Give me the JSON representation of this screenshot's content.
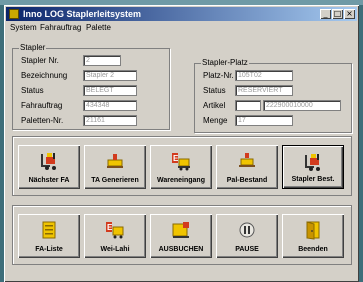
{
  "window": {
    "title": "Inno LOG Staplerleitsystem"
  },
  "menu": [
    "System",
    "Fahrauftrag",
    "Palette"
  ],
  "stapler": {
    "group_label": "Stapler",
    "fields": [
      {
        "label": "Stapler Nr.",
        "value": "2"
      },
      {
        "label": "Bezeichnung",
        "value": "Stapler 2"
      },
      {
        "label": "Status",
        "value": "BELEGT"
      },
      {
        "label": "Fahrauftrag",
        "value": "434348"
      },
      {
        "label": "Paletten-Nr.",
        "value": "21161"
      }
    ]
  },
  "stapler_platz": {
    "group_label": "Stapler-Platz",
    "platz_label": "Platz-Nr.",
    "platz_value": "105T02",
    "status_label": "Status",
    "status_value": "RESERVIERT",
    "artikel_label": "Artikel",
    "artikel_value_1": "",
    "artikel_value_2": "222900010000",
    "menge_label": "Menge",
    "menge_value": "17"
  },
  "buttons_row1": [
    {
      "label": "Nächster FA",
      "icon": "forklift-icon"
    },
    {
      "label": "TA Generieren",
      "icon": "pallet-icon"
    },
    {
      "label": "Wareneingang",
      "icon": "goods-receipt-icon"
    },
    {
      "label": "Pal-Bestand",
      "icon": "pallet-stock-icon"
    },
    {
      "label": "Stapler Best.",
      "icon": "forklift-icon"
    }
  ],
  "buttons_row2": [
    {
      "label": "FA-Liste",
      "icon": "list-icon"
    },
    {
      "label": "Wei-Lahi",
      "icon": "truck-icon"
    },
    {
      "label": "AUSBUCHEN",
      "icon": "checkout-icon"
    },
    {
      "label": "PAUSE",
      "icon": "pause-icon"
    },
    {
      "label": "Beenden",
      "icon": "exit-door-icon"
    }
  ],
  "colors": {
    "titlebar_start": "#0a246a",
    "titlebar_end": "#a6caf0",
    "face": "#d4d0c8",
    "desktop": "#3d6e7a"
  }
}
